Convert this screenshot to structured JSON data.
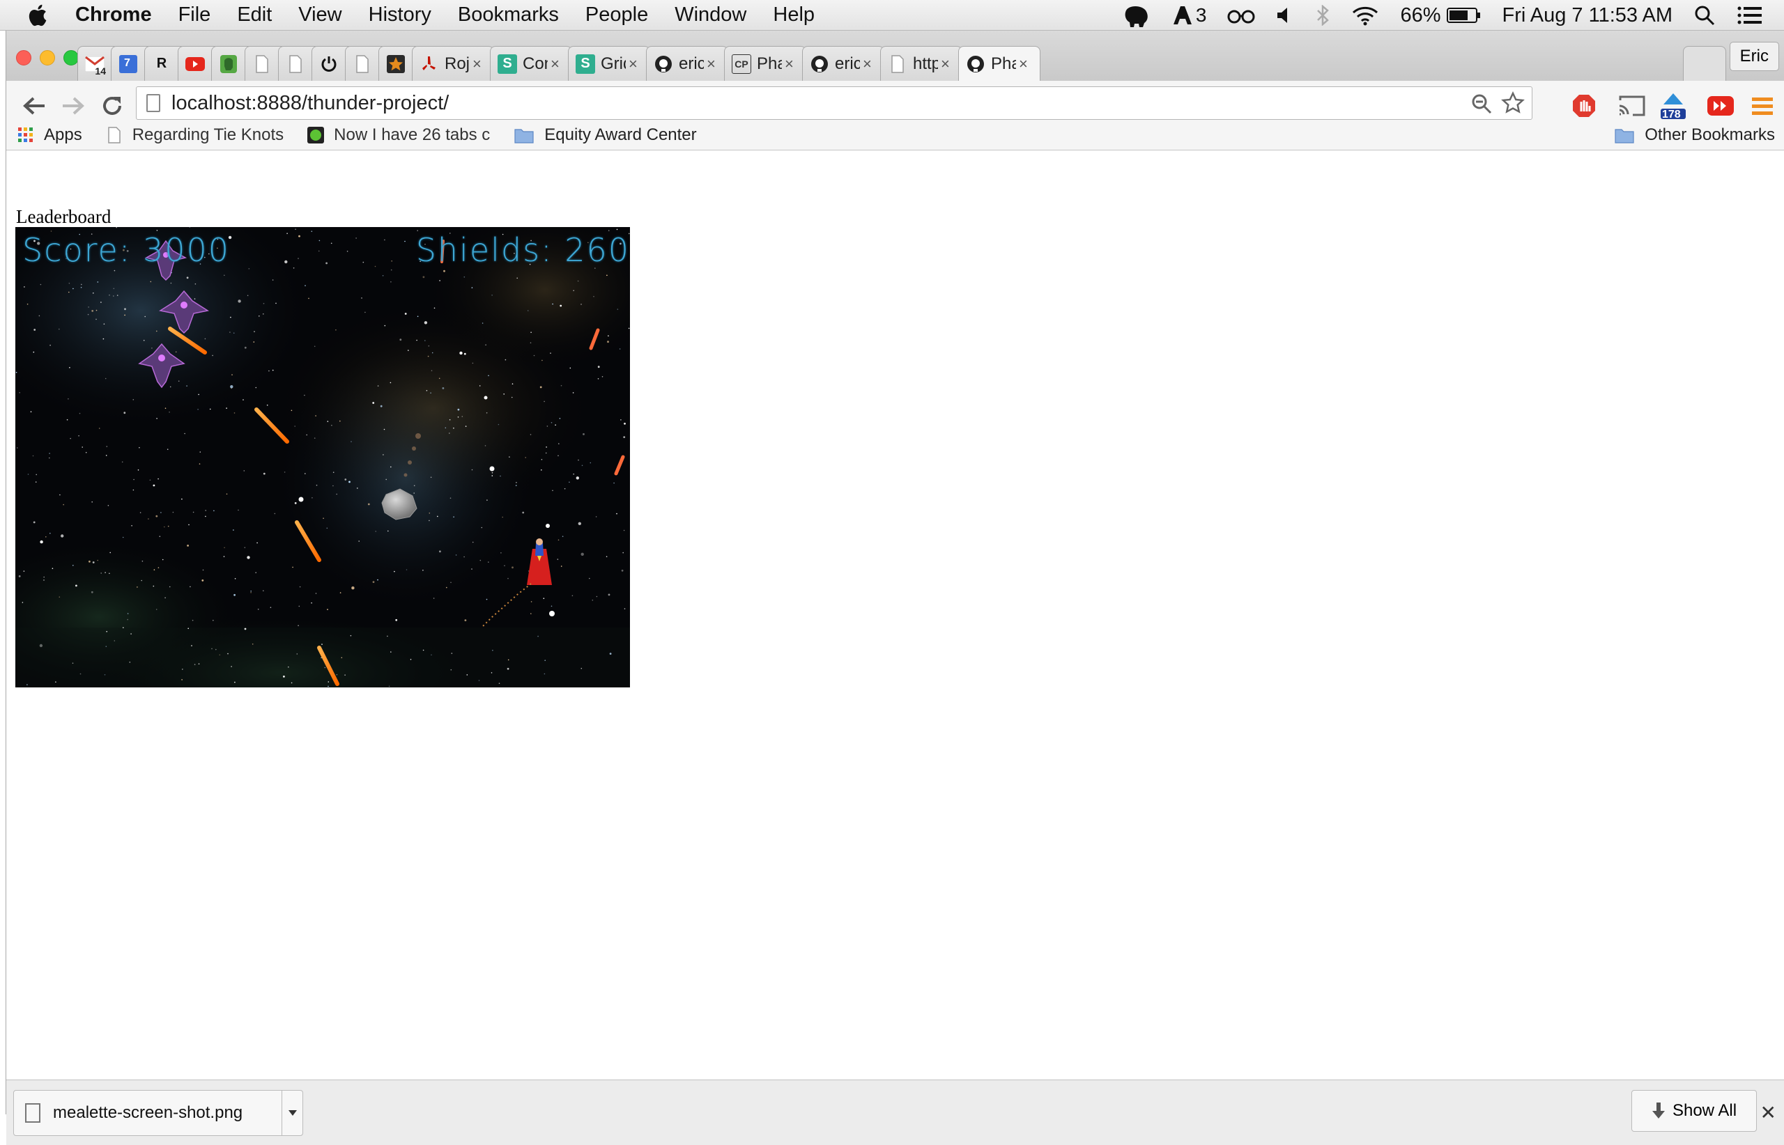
{
  "menubar": {
    "app_name": "Chrome",
    "menus": [
      "File",
      "Edit",
      "View",
      "History",
      "Bookmarks",
      "People",
      "Window",
      "Help"
    ],
    "status": {
      "adobe_count": "3",
      "battery": "66%",
      "clock": "Fri Aug 7  11:53 AM"
    }
  },
  "tabs": [
    {
      "title": "",
      "icon": "gmail-icon",
      "badge": "14"
    },
    {
      "title": "",
      "icon": "calendar-icon",
      "badge": "7"
    },
    {
      "title": "",
      "icon": "r-icon",
      "glyph": "R"
    },
    {
      "title": "",
      "icon": "youtube-icon"
    },
    {
      "title": "",
      "icon": "evernote-icon"
    },
    {
      "title": "",
      "icon": "page-icon"
    },
    {
      "title": "",
      "icon": "page-icon"
    },
    {
      "title": "",
      "icon": "power-icon"
    },
    {
      "title": "",
      "icon": "page-icon"
    },
    {
      "title": "",
      "icon": "star-badge-icon"
    },
    {
      "title": "Rojoz C",
      "icon": "yelp-icon"
    },
    {
      "title": "Contair",
      "icon": "s-icon",
      "glyph": "S"
    },
    {
      "title": "Grid | S",
      "icon": "s-icon",
      "glyph": "S"
    },
    {
      "title": "ericfloi",
      "icon": "github-icon"
    },
    {
      "title": "Phaser",
      "icon": "codepen-icon",
      "glyph": "CP"
    },
    {
      "title": "ericfloi",
      "icon": "github-icon"
    },
    {
      "title": "https://",
      "icon": "page-icon"
    },
    {
      "title": "Phaser",
      "icon": "github-icon",
      "active": true
    }
  ],
  "profile": "Eric",
  "toolbar": {
    "url": "localhost:8888/thunder-project/",
    "ext_badge": "178"
  },
  "bookmarks": {
    "apps": "Apps",
    "items": [
      "Regarding Tie Knots",
      "Now I have 26 tabs c",
      "Equity Award Center"
    ],
    "other": "Other Bookmarks"
  },
  "page": {
    "heading": "Leaderboard",
    "game": {
      "score_text": "Score: 3000",
      "shields_text": "Shields: 260"
    }
  },
  "download_shelf": {
    "filename": "mealette-screen-shot.png",
    "show_all": "Show All"
  },
  "colors": {
    "hud": "#3fa9d6",
    "laser": "#ff8a1a",
    "chrome_accent": "#e8463b"
  }
}
